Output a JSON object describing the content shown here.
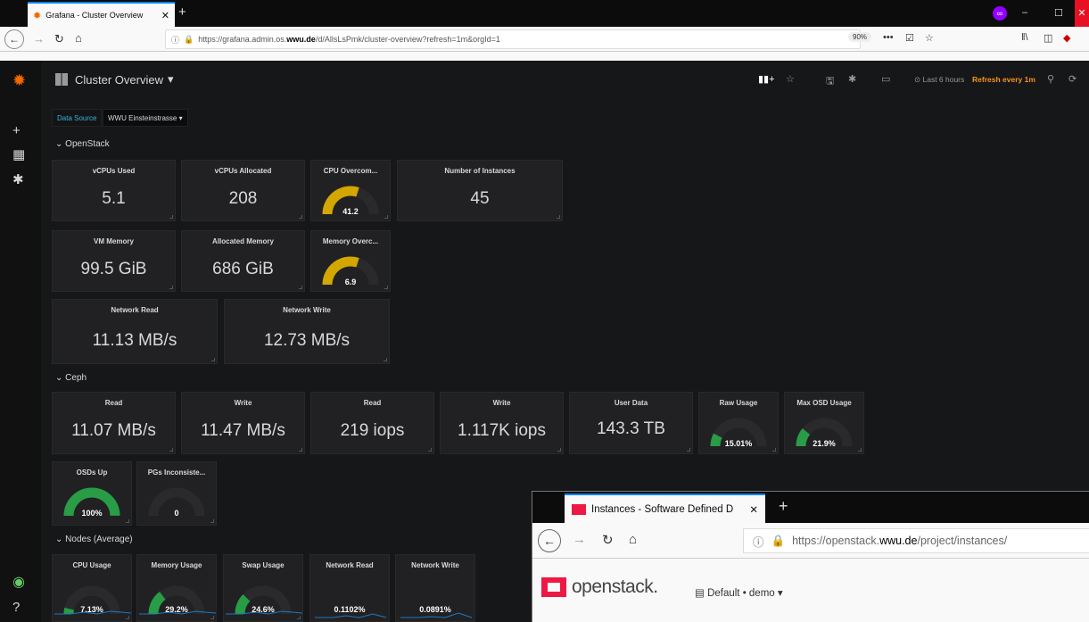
{
  "browser": {
    "tab_title": "Grafana - Cluster Overview",
    "url_prefix": "https://grafana.admin.os.",
    "url_domain": "wwu.de",
    "url_suffix": "/d/AllsLsPmk/cluster-overview?refresh=1m&orgId=1",
    "zoom": "90%"
  },
  "dashboard": {
    "title": "Cluster Overview",
    "time_range": "Last 6 hours",
    "refresh": "Refresh every 1m",
    "variable_label": "Data Source",
    "variable_value": "WWU Einsteinstrasse"
  },
  "rows": {
    "openstack": "OpenStack",
    "ceph": "Ceph",
    "nodes": "Nodes (Average)"
  },
  "openstack": {
    "vcpus_used": {
      "title": "vCPUs Used",
      "value": "5.1"
    },
    "vcpus_alloc": {
      "title": "vCPUs Allocated",
      "value": "208"
    },
    "cpu_over": {
      "title": "CPU Overcom...",
      "value": "41.2",
      "level": 0.6
    },
    "instances": {
      "title": "Number of Instances",
      "value": "45"
    },
    "vm_memory": {
      "title": "VM Memory",
      "value": "99.5 GiB"
    },
    "alloc_memory": {
      "title": "Allocated Memory",
      "value": "686 GiB"
    },
    "mem_over": {
      "title": "Memory Overc...",
      "value": "6.9",
      "level": 0.6
    },
    "net_read": {
      "title": "Network Read",
      "value": "11.13 MB/s"
    },
    "net_write": {
      "title": "Network Write",
      "value": "12.73 MB/s"
    }
  },
  "ceph": {
    "read": {
      "title": "Read",
      "value": "11.07 MB/s"
    },
    "write": {
      "title": "Write",
      "value": "11.47 MB/s"
    },
    "read_iops": {
      "title": "Read",
      "value": "219 iops"
    },
    "write_iops": {
      "title": "Write",
      "value": "1.117K iops"
    },
    "user_data": {
      "title": "User Data",
      "value": "143.3 TB"
    },
    "raw_usage": {
      "title": "Raw Usage",
      "value": "15.01%",
      "level": 0.1501
    },
    "max_osd": {
      "title": "Max OSD Usage",
      "value": "21.9%",
      "level": 0.219
    },
    "osds_up": {
      "title": "OSDs Up",
      "value": "100%",
      "level": 1.0
    },
    "pgs": {
      "title": "PGs Inconsiste...",
      "value": "0",
      "level": 0
    }
  },
  "nodes": {
    "cpu": {
      "title": "CPU Usage",
      "value": "7.13%",
      "level": 0.0713
    },
    "memory": {
      "title": "Memory Usage",
      "value": "29.2%",
      "level": 0.292
    },
    "swap": {
      "title": "Swap Usage",
      "value": "24.6%",
      "level": 0.246
    },
    "net_read": {
      "title": "Network Read",
      "value": "0.1102%"
    },
    "net_write": {
      "title": "Network Write",
      "value": "0.0891%"
    }
  },
  "openstack_window": {
    "tab_title": "Instances - Software Defined D",
    "url_prefix": "https://openstack.",
    "url_domain": "wwu.de",
    "url_suffix": "/project/instances/",
    "brand": "openstack.",
    "project": "Default • demo"
  },
  "colors": {
    "gauge_warn": "#d4a700",
    "gauge_ok": "#299c46",
    "accent": "#f7941d"
  }
}
